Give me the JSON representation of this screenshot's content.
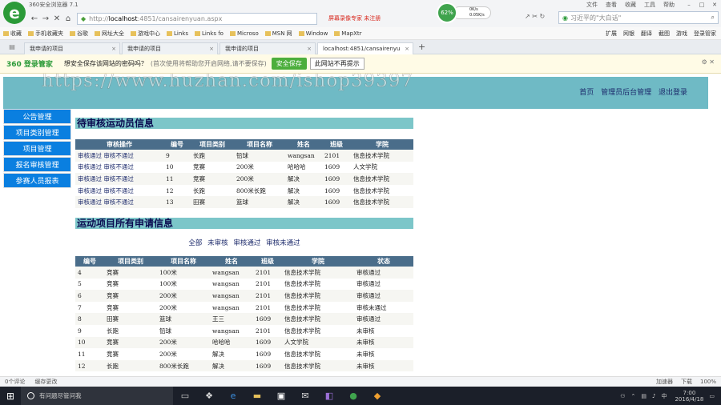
{
  "browser": {
    "title": "360安全浏览器 7.1",
    "menus": [
      "文件",
      "查看",
      "收藏",
      "工具",
      "帮助"
    ],
    "url_prefix": "http://",
    "url_host": "localhost",
    "url_rest": ":4851/cansairenyuan.aspx",
    "record_notice": "屏幕录像专家 未注册",
    "speed_percent": "62%",
    "speed_up": "0K/s",
    "speed_down": "0.05K/s",
    "search_placeholder": "习近平的\"大白话\"",
    "favorites": [
      "收藏",
      "手机收藏夹",
      "谷歌",
      "网址大全",
      "游戏中心",
      "Links",
      "Links fo",
      "Microso",
      "MSN 网",
      "Window",
      "MapXtr"
    ],
    "fav_right": [
      "扩展",
      "网银",
      "翻译",
      "截图",
      "游戏",
      "登录管家"
    ],
    "tabs": [
      {
        "label": "我申请的项目",
        "active": false
      },
      {
        "label": "我申请的项目",
        "active": false
      },
      {
        "label": "我申请的项目",
        "active": false
      },
      {
        "label": "localhost:4851/cansairenyu",
        "active": true
      }
    ],
    "pw_brand": "360 登录管家",
    "pw_question": "想安全保存该网站的密码吗？",
    "pw_hint": "(首次使用将帮助您开启网络,请不要保存)",
    "pw_save": "安全保存",
    "pw_never": "此网站不再提示"
  },
  "page": {
    "watermark": "https://www.huzhan.com/ishop39397",
    "top_links": [
      "首页",
      "管理员后台管理",
      "退出登录"
    ],
    "sidebar": [
      "公告管理",
      "项目类别管理",
      "项目管理",
      "报名审核管理",
      "参赛人员报表"
    ],
    "pending": {
      "title": "待审核运动员信息",
      "headers": [
        "审核操作",
        "编号",
        "项目类别",
        "项目名称",
        "姓名",
        "班级",
        "学院"
      ],
      "approve": "审核通过",
      "reject": "审核不通过",
      "rows": [
        [
          "9",
          "长跑",
          "铅球",
          "wangsan",
          "2101",
          "信息技术学院"
        ],
        [
          "10",
          "竞赛",
          "200米",
          "哈哈哈",
          "1609",
          "人文学院"
        ],
        [
          "11",
          "竞赛",
          "200米",
          "解决",
          "1609",
          "信息技术学院"
        ],
        [
          "12",
          "长跑",
          "800米长跑",
          "解决",
          "1609",
          "信息技术学院"
        ],
        [
          "13",
          "田赛",
          "篮球",
          "解决",
          "1609",
          "信息技术学院"
        ]
      ]
    },
    "all": {
      "title": "运动项目所有申请信息",
      "filters": [
        "全部",
        "未审核",
        "审核通过",
        "审核未通过"
      ],
      "headers": [
        "编号",
        "项目类别",
        "项目名称",
        "姓名",
        "班级",
        "学院",
        "状态"
      ],
      "rows": [
        [
          "4",
          "竞赛",
          "100米",
          "wangsan",
          "2101",
          "信息技术学院",
          "审核通过"
        ],
        [
          "5",
          "竞赛",
          "100米",
          "wangsan",
          "2101",
          "信息技术学院",
          "审核通过"
        ],
        [
          "6",
          "竞赛",
          "200米",
          "wangsan",
          "2101",
          "信息技术学院",
          "审核通过"
        ],
        [
          "7",
          "竞赛",
          "200米",
          "wangsan",
          "2101",
          "信息技术学院",
          "审核未通过"
        ],
        [
          "8",
          "田赛",
          "篮球",
          "王三",
          "1609",
          "信息技术学院",
          "审核通过"
        ],
        [
          "9",
          "长跑",
          "铅球",
          "wangsan",
          "2101",
          "信息技术学院",
          "未审核"
        ],
        [
          "10",
          "竞赛",
          "200米",
          "哈哈哈",
          "1609",
          "人文学院",
          "未审核"
        ],
        [
          "11",
          "竞赛",
          "200米",
          "解决",
          "1609",
          "信息技术学院",
          "未审核"
        ],
        [
          "12",
          "长跑",
          "800米长跑",
          "解决",
          "1609",
          "信息技术学院",
          "未审核"
        ]
      ]
    }
  },
  "statusbar": {
    "left": [
      "0个评论",
      "缓存更改"
    ],
    "right": [
      "加速器",
      "下载",
      "100%"
    ]
  },
  "taskbar": {
    "search": "有问题尽管问我",
    "time": "7:00",
    "date": "2016/4/18"
  },
  "colors": {
    "banner": "#6fbac5",
    "sidebar": "#0a7fe0",
    "table_header": "#4a6d8a",
    "section_bar": "#7cc6c9",
    "link": "#1c2a6b"
  }
}
